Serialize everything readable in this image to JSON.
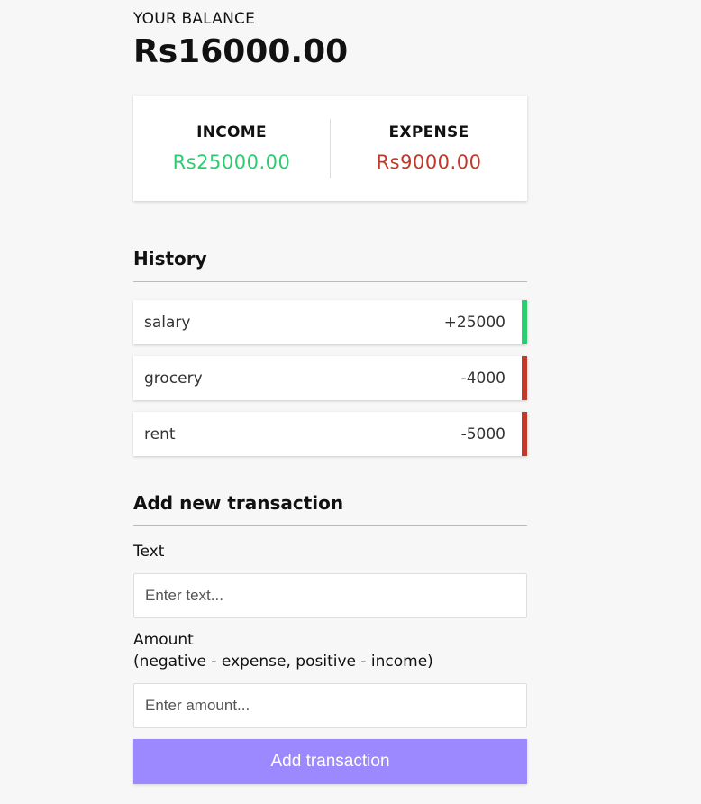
{
  "balance": {
    "label": "YOUR BALANCE",
    "value": "Rs16000.00"
  },
  "summary": {
    "income_label": "INCOME",
    "income_value": "Rs25000.00",
    "expense_label": "EXPENSE",
    "expense_value": "Rs9000.00"
  },
  "history": {
    "title": "History",
    "items": [
      {
        "text": "salary",
        "amount": "+25000",
        "type": "plus"
      },
      {
        "text": "grocery",
        "amount": "-4000",
        "type": "minus"
      },
      {
        "text": "rent",
        "amount": "-5000",
        "type": "minus"
      }
    ]
  },
  "form": {
    "title": "Add new transaction",
    "text_label": "Text",
    "text_placeholder": "Enter text...",
    "amount_label": "Amount",
    "amount_hint": "(negative - expense, positive - income)",
    "amount_placeholder": "Enter amount...",
    "submit_label": "Add transaction"
  },
  "colors": {
    "income": "#2ecc71",
    "expense": "#c0392b",
    "button": "#9c88ff"
  }
}
